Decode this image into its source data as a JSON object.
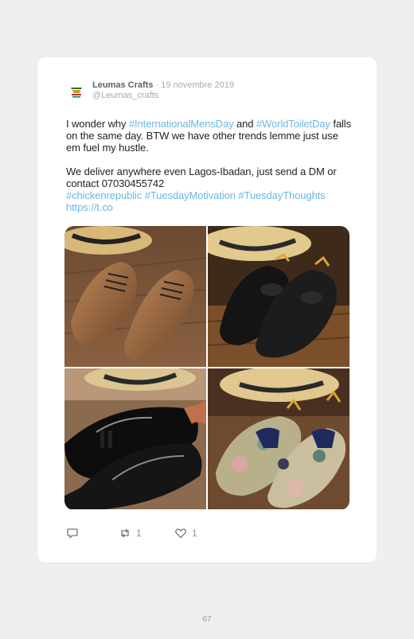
{
  "tweet": {
    "author_name": "Leumas Crafts",
    "separator": " · ",
    "date": "19 novembre 2019",
    "handle": "@Leumas_crafts",
    "line1_pre": "I wonder why ",
    "tag1": "#InternationalMensDay",
    "line1_mid": " and ",
    "tag2": "#WorldToiletDay",
    "line1_post": " falls on the same day. BTW we have other trends lemme just use em fuel my hustle.",
    "line2": "We deliver anywhere even Lagos-Ibadan, just send a DM or contact 07030455742",
    "tag3": "#chickenrepublic",
    "tag4": "#TuesdayMotivation",
    "tag5": "#TuesdayThoughts",
    "link": "https://t.co"
  },
  "actions": {
    "reply_icon": "reply-icon",
    "retweet_icon": "retweet-icon",
    "retweet_count": "1",
    "like_icon": "heart-icon",
    "like_count": "1"
  },
  "photos": [
    "tan-derby-shoes",
    "black-brogue-loafers",
    "patent-tassel-loafers",
    "floral-tassel-loafers"
  ],
  "page_number": "67",
  "colors": {
    "hashtag": "#6cb6e2",
    "background": "#efefef",
    "card": "#ffffff"
  }
}
